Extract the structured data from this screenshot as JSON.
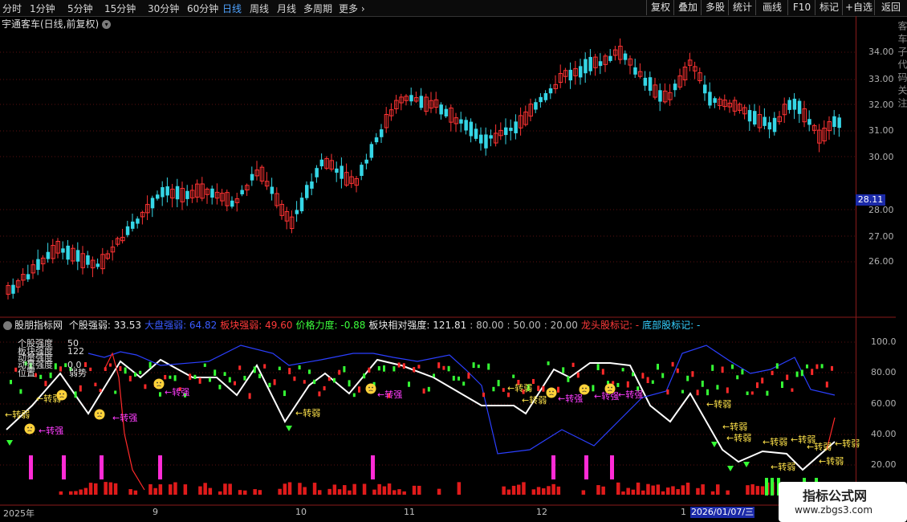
{
  "toolbar": {
    "tabs": [
      "分时",
      "1分钟",
      "5分钟",
      "15分钟",
      "30分钟",
      "60分钟",
      "日线",
      "周线",
      "月线",
      "多周期",
      "更多 ›"
    ],
    "active": "日线",
    "right_buttons": [
      "复权",
      "叠加",
      "多股",
      "统计",
      "画线",
      "F10",
      "标记",
      "+自选",
      "返回"
    ]
  },
  "chart_title": "宇通客车(日线,前复权)",
  "price_axis": [
    "34.00",
    "33.00",
    "32.00",
    "31.00",
    "30.00",
    "28.00",
    "27.00",
    "26.00"
  ],
  "price_marker": "28.11",
  "indicator_header": {
    "name": "股朋指标网",
    "items": [
      {
        "label": "个股强弱:",
        "value": "33.53",
        "color": "#e8e8e8"
      },
      {
        "label": "大盘强弱:",
        "value": "64.82",
        "color": "#3a5bff"
      },
      {
        "label": "板块强弱:",
        "value": "49.60",
        "color": "#ff3a3a"
      },
      {
        "label": "价格力度:",
        "value": "-0.88",
        "color": "#3cff3c"
      },
      {
        "label": "板块相对强度:",
        "value": "121.81",
        "color": "#e8e8e8"
      },
      {
        "label": "",
        "value": "80.00",
        "color": "#bbbbbb"
      },
      {
        "label": "",
        "value": "50.00",
        "color": "#bbbbbb"
      },
      {
        "label": "",
        "value": "20.00",
        "color": "#bbbbbb"
      },
      {
        "label": "龙头股标记:",
        "value": "-",
        "color": "#ff3a3a"
      },
      {
        "label": "底部股标记:",
        "value": "-",
        "color": "#35d0ff"
      }
    ]
  },
  "indicator_legend": [
    {
      "label": "个股强度",
      "value": "50"
    },
    {
      "label": "板块强度",
      "value": "122"
    },
    {
      "label": "动量强度",
      "value": ""
    },
    {
      "label": "动量强度",
      "value": "0.0"
    },
    {
      "label": "位置",
      "value": "弱势"
    }
  ],
  "indicator_axis": [
    "100.0",
    "80.00",
    "60.00",
    "40.00",
    "20.00"
  ],
  "annotations": {
    "up": "←转强",
    "down": "←转弱"
  },
  "time_axis": [
    "2025年",
    "9",
    "10",
    "11",
    "12",
    "1"
  ],
  "selected_date": "2026/01/07/三",
  "watermark": {
    "title": "指标公式网",
    "url": "www.zbgs3.com"
  },
  "side_text": "客车子代码关注"
}
